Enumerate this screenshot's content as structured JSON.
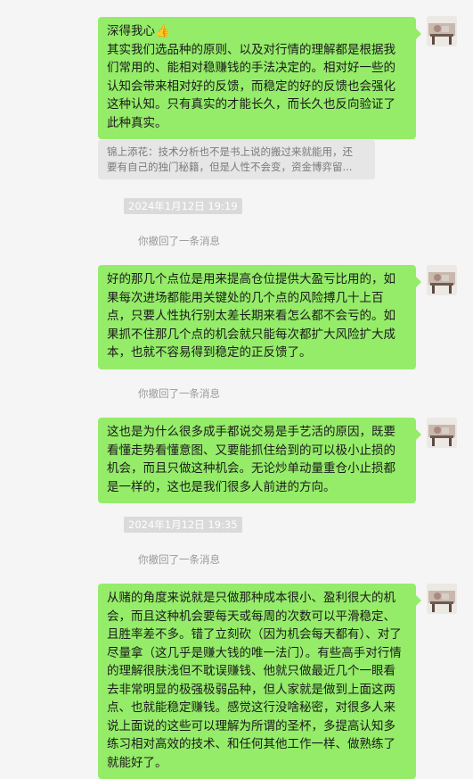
{
  "messages": [
    {
      "text": "深得我心👍\n其实我们选品种的原则、以及对行情的理解都是根据我们常用的、能相对稳赚钱的手法决定的。相对好一些的认知会带来相对好的反馈，而稳定的好的反馈也会强化这种认知。只有真实的才能长久，而长久也反向验证了此种真实。"
    },
    {
      "text": "好的那几个点位是用来提高仓位提供大盈亏比用的，如果每次进场都能用关键处的几个点的风险搏几十上百点，只要人性执行别太差长期来看怎么都不会亏的。如果抓不住那几个点的机会就只能每次都扩大风险扩大成本，也就不容易得到稳定的正反馈了。"
    },
    {
      "text": "这也是为什么很多成手都说交易是手艺活的原因，既要看懂走势看懂意图、又要能抓住给到的可以极小止损的机会，而且只做这种机会。无论炒单动量重仓小止损都是一样的，这也是我们很多人前进的方向。"
    },
    {
      "text": "从赌的角度来说就是只做那种成本很小、盈利很大的机会，而且这种机会要每天或每周的次数可以平滑稳定、且胜率差不多。错了立刻砍（因为机会每天都有）、对了尽量拿（这几乎是赚大钱的唯一法门）。有些高手对行情的理解很肤浅但不耽误赚钱、他就只做最近几个一眼看去非常明显的极强极弱品种，但人家就是做到上面这两点、也就能稳定赚钱。感觉这行没啥秘密，对很多人来说上面说的这些可以理解为所谓的圣杯，多提高认知多练习相对高效的技术、和任何其他工作一样、做熟练了就能好了。"
    }
  ],
  "quote": {
    "line1": "锦上添花：技术分析也不是书上说的搬过来就能用，还",
    "line2": "要有自己的独门秘籍，但是人性不会变，资金博弈留..."
  },
  "timestamps": [
    "2024年1月12日 19:19",
    "2024年1月12日 19:35"
  ],
  "recall_notice": "你撤回了一条消息",
  "colors": {
    "bubble": "#95ec69",
    "background": "#f5f5f5",
    "quote_bg": "#e6e6e6",
    "timestamp_bg": "#dadada"
  }
}
